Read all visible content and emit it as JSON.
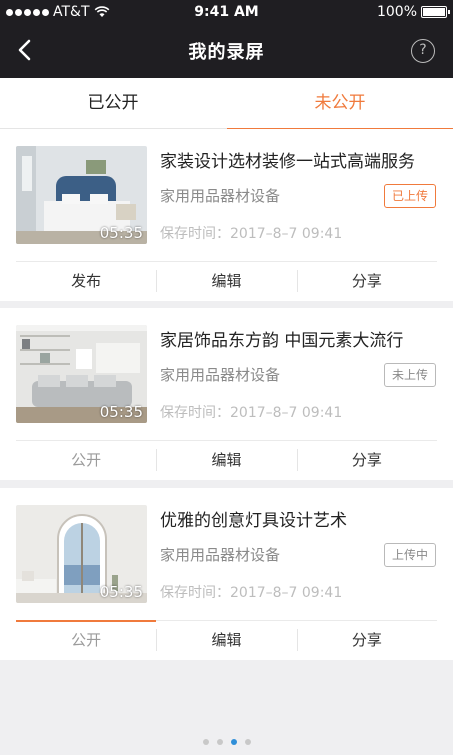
{
  "status_bar": {
    "carrier": "AT&T",
    "time": "9:41 AM",
    "battery": "100%"
  },
  "header": {
    "title": "我的录屏",
    "help": "?"
  },
  "tabs": [
    {
      "label": "已公开"
    },
    {
      "label": "未公开"
    }
  ],
  "cards": [
    {
      "title": "家装设计选材装修一站式高端服务",
      "category": "家用用品器材设备",
      "badge": "已上传",
      "time": "保存时间：2017–8–7 09:41",
      "duration": "05:35",
      "actions": [
        "发布",
        "编辑",
        "分享"
      ]
    },
    {
      "title": "家居饰品东方韵 中国元素大流行",
      "category": "家用用品器材设备",
      "badge": "未上传",
      "time": "保存时间：2017–8–7 09:41",
      "duration": "05:35",
      "actions": [
        "公开",
        "编辑",
        "分享"
      ]
    },
    {
      "title": "优雅的创意灯具设计艺术",
      "category": "家用用品器材设备",
      "badge": "上传中",
      "time": "保存时间：2017–8–7 09:41",
      "duration": "05:35",
      "actions": [
        "公开",
        "编辑",
        "分享"
      ]
    }
  ],
  "pager": {
    "count": 4,
    "active_index": 2
  },
  "colors": {
    "accent": "#f07a3c",
    "header_bg": "#1f1e22",
    "pager_active": "#2f8fd8"
  }
}
